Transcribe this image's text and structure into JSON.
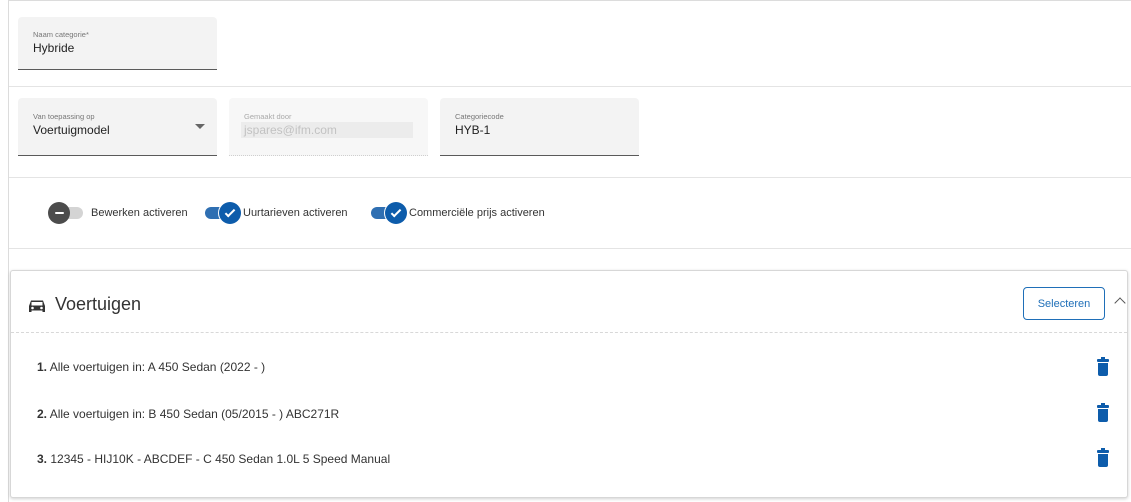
{
  "form": {
    "name_label": "Naam categorie*",
    "name_value": "Hybride",
    "apply_label": "Van toepassing op",
    "apply_value": "Voertuigmodel",
    "created_label": "Gemaakt door",
    "created_value": "jspares@ifm.com",
    "code_label": "Categoriecode",
    "code_value": "HYB-1"
  },
  "toggles": [
    {
      "label": "Bewerken activeren",
      "state": "off"
    },
    {
      "label": "Uurtarieven activeren",
      "state": "on"
    },
    {
      "label": "Commerciële prijs activeren",
      "state": "on"
    }
  ],
  "vehicles": {
    "title": "Voertuigen",
    "select_label": "Selecteren",
    "items": [
      {
        "num": "1.",
        "text": " Alle voertuigen in: A 450 Sedan (2022 - )"
      },
      {
        "num": "2.",
        "text": " Alle voertuigen in: B 450 Sedan (05/2015 - ) ABC271R"
      },
      {
        "num": "3.",
        "text": " 12345 - HIJ10K - ABCDEF - C 450 Sedan 1.0L 5 Speed Manual"
      }
    ]
  },
  "colors": {
    "accent": "#0d5cab",
    "toggle_off": "#4c4c4c"
  },
  "icons": [
    "car-icon",
    "dropdown-arrow-icon",
    "chevron-up-icon",
    "trash-icon",
    "checkmark-icon",
    "minus-icon"
  ]
}
